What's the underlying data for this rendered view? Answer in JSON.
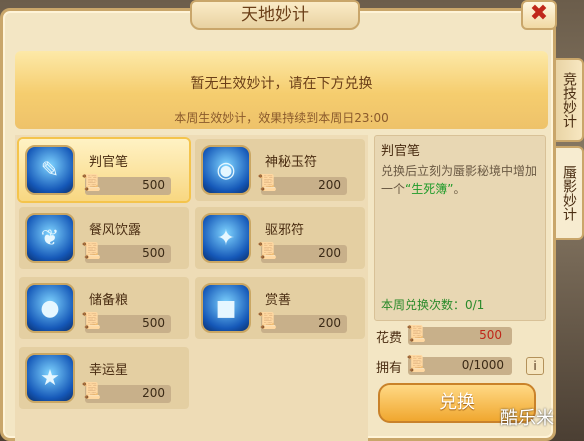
{
  "window": {
    "title": "天地妙计",
    "close_label": "✖"
  },
  "banner": {
    "main_text": "暂无生效妙计，请在下方兑换",
    "sub_text": "本周生效妙计，效果持续到本周日23:00"
  },
  "side_tabs": [
    {
      "label": "竞技妙计"
    },
    {
      "label": "蜃影妙计"
    }
  ],
  "items": [
    {
      "name": "判官笔",
      "price": "500",
      "icon": "brush-icon"
    },
    {
      "name": "神秘玉符",
      "price": "200",
      "icon": "jade-talisman-icon"
    },
    {
      "name": "餐风饮露",
      "price": "500",
      "icon": "leaf-icon"
    },
    {
      "name": "驱邪符",
      "price": "200",
      "icon": "talisman-icon"
    },
    {
      "name": "储备粮",
      "price": "500",
      "icon": "sack-icon"
    },
    {
      "name": "赏善",
      "price": "200",
      "icon": "gift-box-icon"
    },
    {
      "name": "幸运星",
      "price": "200",
      "icon": "star-icon"
    }
  ],
  "detail": {
    "title": "判官笔",
    "desc_before": "兑换后立刻为蜃影秘境中增加一个",
    "desc_highlight": "“生死簿”",
    "desc_after": "。",
    "weekly_count": "本周兑换次数：0/1"
  },
  "cost": {
    "label": "花费",
    "value": "500"
  },
  "own": {
    "label": "拥有",
    "value": "0/1000",
    "info_label": "i"
  },
  "exchange_label": "兑换",
  "watermark": "酷乐米",
  "colors": {
    "accent_red": "#c0271a",
    "highlight_green": "#1f9b2a",
    "button_orange": "#f0a72f"
  }
}
